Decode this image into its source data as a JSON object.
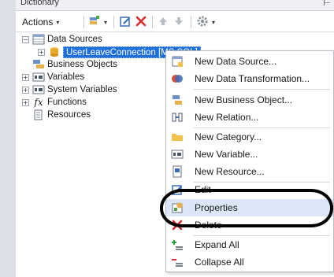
{
  "panel": {
    "title": "Dictionary",
    "pin_glyph": "⊢"
  },
  "toolbar": {
    "actions_label": "Actions",
    "actions_caret": "▾",
    "new_caret": "▾",
    "settings_caret": "▾",
    "icons": [
      "new-item-icon",
      "edit-icon",
      "delete-icon",
      "move-up-icon",
      "move-down-icon",
      "settings-icon"
    ]
  },
  "tree": {
    "data_sources": {
      "label": "Data Sources",
      "expander": "−"
    },
    "connection": {
      "label": "UserLeaveConnection [MS SQL]",
      "expander": "+"
    },
    "business_objects": {
      "label": "Business Objects"
    },
    "variables": {
      "label": "Variables",
      "expander": "+"
    },
    "system_variables": {
      "label": "System Variables",
      "expander": "+"
    },
    "functions": {
      "label": "Functions",
      "expander": "+",
      "glyph": "fx"
    },
    "resources": {
      "label": "Resources"
    }
  },
  "context_menu": {
    "items": [
      {
        "label": "New Data Source...",
        "icon": "data-source-icon"
      },
      {
        "label": "New Data Transformation...",
        "icon": "data-transformation-icon"
      },
      {
        "label": "New Business Object...",
        "icon": "business-object-icon"
      },
      {
        "label": "New Relation...",
        "icon": "relation-icon"
      },
      {
        "label": "New Category...",
        "icon": "folder-icon"
      },
      {
        "label": "New Variable...",
        "icon": "variable-icon"
      },
      {
        "label": "New Resource...",
        "icon": "resource-icon"
      },
      {
        "label": "Edit",
        "icon": "edit-icon"
      },
      {
        "label": "Properties",
        "icon": "properties-icon"
      },
      {
        "label": "Delete",
        "icon": "delete-icon"
      },
      {
        "label": "Expand All",
        "icon": "expand-all-icon"
      },
      {
        "label": "Collapse All",
        "icon": "collapse-all-icon"
      }
    ],
    "highlighted": "Properties"
  },
  "colors": {
    "selection": "#1e6fd9",
    "highlight": "#dbe7f7",
    "delete_red": "#d92b2b",
    "annotation": "#000000"
  }
}
